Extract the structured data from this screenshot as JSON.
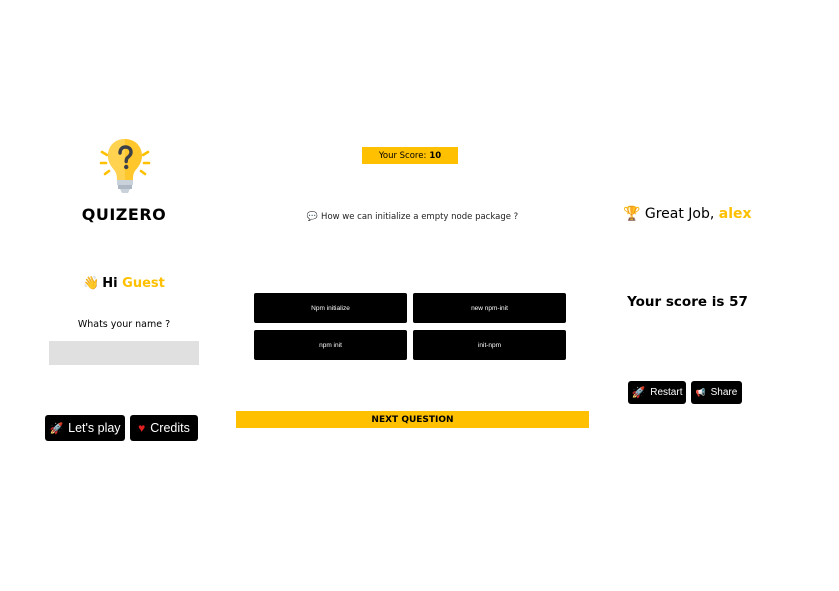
{
  "brand": {
    "name": "QUIZERO"
  },
  "welcome": {
    "hi": "Hi",
    "guest": "Guest",
    "name_label": "Whats your name ?",
    "name_value": "",
    "name_placeholder": "",
    "play_label": "Let's play",
    "credits_label": "Credits"
  },
  "quiz": {
    "score_label": "Your Score:",
    "score_value": "10",
    "question": "How we can initialize a empty node package ?",
    "options": [
      {
        "label": "Npm initialize"
      },
      {
        "label": "new npm-init"
      },
      {
        "label": "npm init"
      },
      {
        "label": "init-npm"
      }
    ],
    "next_label": "NEXT QUESTION"
  },
  "result": {
    "great_prefix": "Great Job,",
    "username": "alex",
    "final_score_text": "Your score is 57",
    "restart_label": "Restart",
    "share_label": "Share"
  },
  "colors": {
    "accent": "#ffc000",
    "button_bg": "#000000",
    "input_bg": "#e0e0e0"
  },
  "icons": {
    "logo": "lightbulb-question-icon",
    "wave": "waving-hand-icon",
    "rocket": "rocket-icon",
    "heart": "heart-icon",
    "chat": "speech-bubble-icon",
    "trophy": "trophy-icon",
    "megaphone": "megaphone-icon"
  }
}
